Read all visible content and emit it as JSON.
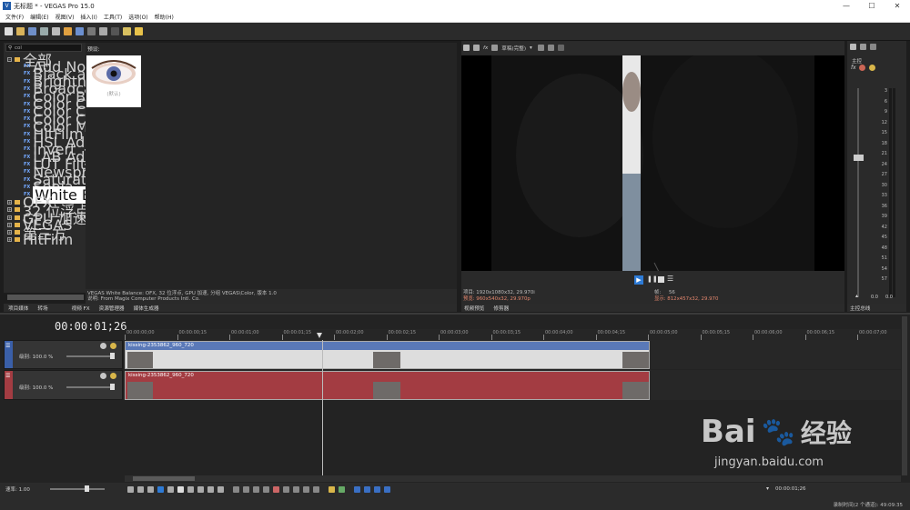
{
  "window": {
    "title": "无标题 * - VEGAS Pro 15.0",
    "minimize": "—",
    "maximize": "☐",
    "close": "✕"
  },
  "menu": [
    "文件(F)",
    "编辑(E)",
    "视图(V)",
    "插入(I)",
    "工具(T)",
    "选项(O)",
    "帮助(H)"
  ],
  "fx_panel": {
    "search_value": "col",
    "root": "全部",
    "fx_items": [
      "Add Noise",
      "Black and White",
      "Brightness and Cor",
      "Broadcast Colors",
      "Color Balance",
      "Color Corrector",
      "Color Corrector (Se",
      "Color Curves",
      "Color Match",
      "HitFilm Three Strip",
      "HSL Adjust",
      "Invert",
      "LAB Adjust",
      "LUT Filter",
      "Newsprint",
      "Saturation Adjust",
      "Sepia",
      "White Balance"
    ],
    "selected": "White Balance",
    "fx_badge": "FX",
    "folders": [
      "OFX",
      "32 位浮点",
      "GPU 加速",
      "VEGAS",
      "第三方",
      "HitFilm"
    ],
    "tabs": [
      "项目媒体",
      "转场",
      "视频 FX",
      "资源管理器",
      "媒体生成器"
    ]
  },
  "presets": {
    "label": "预设:",
    "thumb_caption": "(默认)",
    "status_line1": "VEGAS White Balance: OFX, 32 位浮点, GPU 加速, 分组 VEGAS\\Color, 版本 1.0",
    "status_line2": "说明: From Magix Computer Products Intl. Co."
  },
  "preview": {
    "quality": "草稿(完整)",
    "info_project": "项目: 1920x1080x32, 29.970i",
    "info_preview": "预览: 960x540x32, 29.970p",
    "info_frame": "帧:",
    "frame_value": "56",
    "info_display": "显示: 812x457x32, 29.970",
    "tabs": [
      "视频预览",
      "修剪器"
    ]
  },
  "master": {
    "label": "主控",
    "db_scale": [
      "3",
      "6",
      "9",
      "12",
      "15",
      "18",
      "21",
      "24",
      "27",
      "30",
      "33",
      "36",
      "39",
      "42",
      "45",
      "48",
      "51",
      "54",
      "57"
    ],
    "level_l": "0.0",
    "level_r": "0.0",
    "tab": "主控总线"
  },
  "timeline": {
    "timecode": "00:00:01;26",
    "ruler": [
      "00:00:00;00",
      "00:00:00;15",
      "00:00:01;00",
      "00:00:01;15",
      "00:00:02;00",
      "00:00:02;15",
      "00:00:03;00",
      "00:00:03;15",
      "00:00:04;00",
      "00:00:04;15",
      "00:00:05;00",
      "00:00:05;15",
      "00:00:06;00",
      "00:00:06;15",
      "00:00:07;00"
    ],
    "tracks": [
      {
        "level": "级别: 100.0 %",
        "clip": "kissing-2353862_960_720",
        "color": "#5a79b8"
      },
      {
        "level": "级别: 100.0 %",
        "clip": "kissing-2353862_960_720",
        "color": "#a33c42"
      }
    ]
  },
  "bottom": {
    "rate": "速率: 1.00",
    "cursor_time": "00:00:01;26"
  },
  "status": {
    "record_time": "录制时间(2 个通道): 49:09:35"
  },
  "watermark": {
    "brand": "Bai",
    "brand2": "经验",
    "url": "jingyan.baidu.com"
  }
}
